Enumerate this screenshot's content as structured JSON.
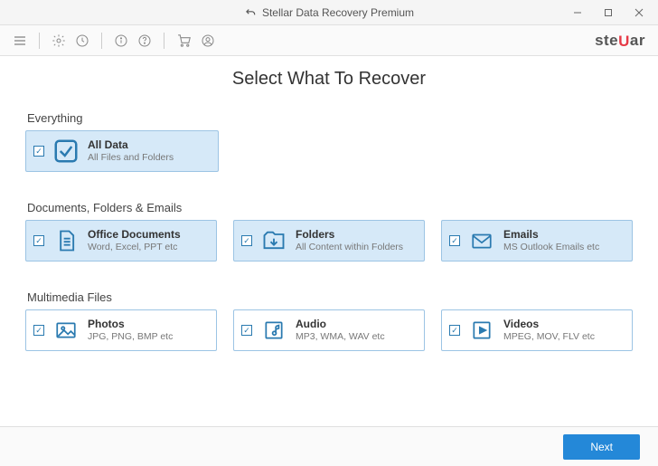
{
  "window": {
    "title": "Stellar Data Recovery Premium"
  },
  "brand": {
    "name": "stellar"
  },
  "page": {
    "title": "Select What To Recover"
  },
  "sections": {
    "everything": {
      "label": "Everything",
      "card": {
        "title": "All Data",
        "sub": "All Files and Folders"
      }
    },
    "docs": {
      "label": "Documents, Folders & Emails",
      "office": {
        "title": "Office Documents",
        "sub": "Word, Excel, PPT etc"
      },
      "folders": {
        "title": "Folders",
        "sub": "All Content within Folders"
      },
      "emails": {
        "title": "Emails",
        "sub": "MS Outlook Emails etc"
      }
    },
    "media": {
      "label": "Multimedia Files",
      "photos": {
        "title": "Photos",
        "sub": "JPG, PNG, BMP etc"
      },
      "audio": {
        "title": "Audio",
        "sub": "MP3, WMA, WAV etc"
      },
      "videos": {
        "title": "Videos",
        "sub": "MPEG, MOV, FLV etc"
      }
    }
  },
  "footer": {
    "next": "Next"
  },
  "colors": {
    "accent": "#2488d8",
    "cardBorder": "#9cc4e4",
    "selectedBg": "#d6e9f8"
  }
}
